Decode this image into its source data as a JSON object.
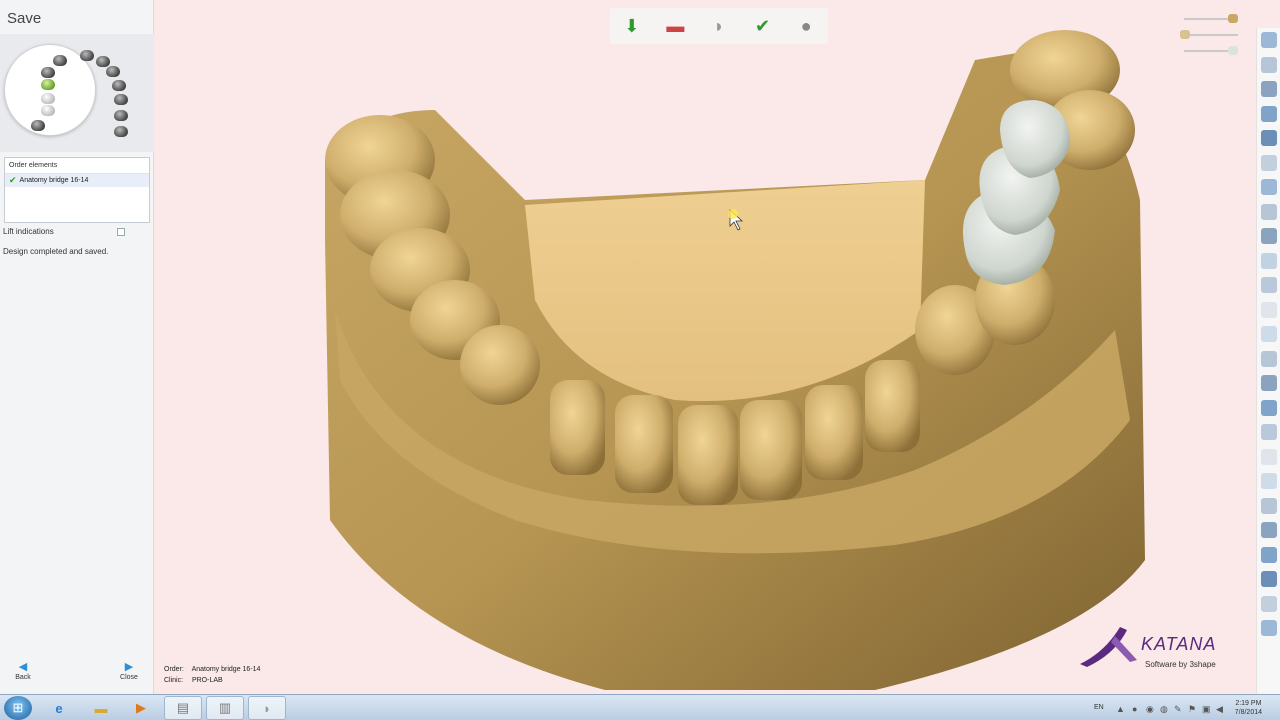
{
  "left_panel": {
    "title": "Save",
    "order_elements_header": "Order elements",
    "order_items": [
      {
        "label": "Anatomy bridge 16-14",
        "checked": true
      }
    ],
    "lift_indications_label": "Lift indications",
    "lift_indications_checked": false,
    "status": "Design completed and saved.",
    "back_label": "Back",
    "close_label": "Close"
  },
  "top_toolbar": {
    "icons": [
      "export-model-icon",
      "die-icon",
      "tooth-icon",
      "approve-tooth-icon",
      "sphere-icon"
    ]
  },
  "viewport": {
    "order_key": "Order:",
    "order_value": "Anatomy bridge 16-14",
    "clinic_key": "Clinic:",
    "clinic_value": "PRO-LAB",
    "logo_text": "KATANA",
    "logo_sub": "Software by 3shape"
  },
  "right_toolbar": {
    "icons": [
      "fullscreen-icon",
      "globe-icon",
      "graduation-cap-icon",
      "copy-icon",
      "window-icon",
      "document-icon",
      "window-icon",
      "jaw-icon",
      "jaw-icon",
      "jaw-icon",
      "jaw-icon",
      "tooth-tool-icon",
      "measure-icon",
      "cube-icon",
      "sphere-icon",
      "warning-icon",
      "square-icon",
      "cube-icon",
      "cube-icon",
      "shield-icon",
      "cross-icon",
      "ruler-icon",
      "scanner-icon",
      "color-wheel-icon",
      "cylinder-icon"
    ]
  },
  "taskbar": {
    "language": "EN",
    "time": "2:19 PM",
    "date": "7/8/2014"
  },
  "colors": {
    "background": "#fbe8e8",
    "model": "#d7b877",
    "crown": "#d8ddd8",
    "accent": "#2e8fd4",
    "logo": "#5b2a80"
  }
}
